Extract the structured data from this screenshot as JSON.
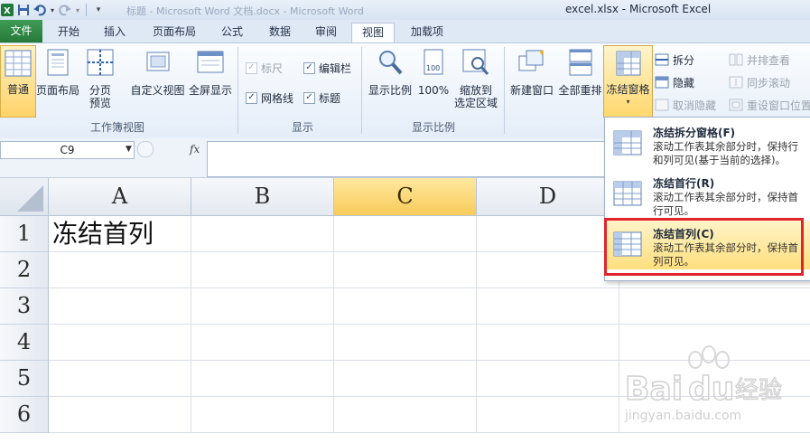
{
  "window": {
    "title": "excel.xlsx - Microsoft Excel",
    "ghost_title": "标题 - Microsoft Word 文档.docx - Microsoft Word"
  },
  "tabs": [
    "文件",
    "开始",
    "插入",
    "页面布局",
    "公式",
    "数据",
    "审阅",
    "视图",
    "加载项"
  ],
  "active_tab": "视图",
  "ribbon": {
    "workbook_views": {
      "label": "工作簿视图",
      "normal": "普通",
      "page_layout": "页面布局",
      "page_break_1": "分页",
      "page_break_2": "预览",
      "custom_views": "自定义视图",
      "full_screen": "全屏显示"
    },
    "show": {
      "label": "显示",
      "ruler": "标尺",
      "formula_bar": "编辑栏",
      "gridlines": "网格线",
      "headings": "标题",
      "ruler_checked": true,
      "formula_bar_checked": true,
      "gridlines_checked": true,
      "headings_checked": true
    },
    "zoom": {
      "label": "显示比例",
      "zoom": "显示比例",
      "hundred": "100%",
      "zoom_to_selection_1": "缩放到",
      "zoom_to_selection_2": "选定区域"
    },
    "window": {
      "new_window": "新建窗口",
      "arrange_all": "全部重排",
      "freeze_panes": "冻结窗格",
      "split": "拆分",
      "hide": "隐藏",
      "unhide": "取消隐藏",
      "side_by_side": "并排查看",
      "sync_scroll": "同步滚动",
      "reset_position": "重设窗口位置"
    }
  },
  "formula_bar": {
    "name_box": "C9",
    "fx": "fx",
    "value": ""
  },
  "grid": {
    "columns": [
      "A",
      "B",
      "C",
      "D"
    ],
    "selected_column": "C",
    "rows": [
      "1",
      "2",
      "3",
      "4",
      "5",
      "6"
    ],
    "cell_a1": "冻结首列"
  },
  "freeze_menu": {
    "items": [
      {
        "title": "冻结拆分窗格(F)",
        "desc": "滚动工作表其余部分时，保持行和列可见(基于当前的选择)。"
      },
      {
        "title": "冻结首行(R)",
        "desc": "滚动工作表其余部分时，保持首行可见。"
      },
      {
        "title": "冻结首列(C)",
        "desc": "滚动工作表其余部分时，保持首列可见。"
      }
    ],
    "highlighted_index": 2
  },
  "watermark": {
    "brand": "Bai",
    "brand2": "du",
    "brand_cn": "经验",
    "url": "jingyan.baidu.com"
  },
  "colors": {
    "file_tab": "#2e8a45",
    "selection": "#f8cb5a",
    "highlight_frame": "#e0232c"
  }
}
